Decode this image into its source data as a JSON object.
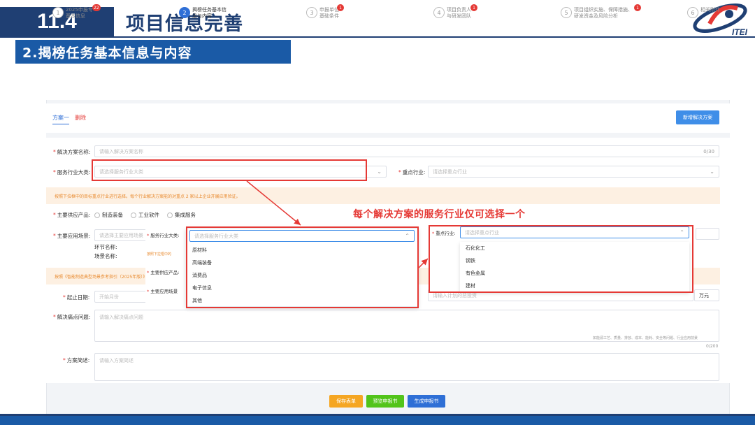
{
  "header": {
    "section_number": "11.4",
    "title": "项目信息完善",
    "subtitle": "2.揭榜任务基本信息与内容",
    "logo_text": "ITEI"
  },
  "steps": [
    {
      "num": "1",
      "label1": "2025申报专",
      "label2": "基本信息",
      "badge": "22"
    },
    {
      "num": "2",
      "label1": "揭榜任务基本信",
      "label2": "息与内容",
      "badge": ""
    },
    {
      "num": "3",
      "label1": "申报单位",
      "label2": "基础条件",
      "badge": "1"
    },
    {
      "num": "4",
      "label1": "项目负责人",
      "label2": "与研发团队",
      "badge": "1"
    },
    {
      "num": "5",
      "label1": "项目组织实施、保障措施、",
      "label2": "研发资金及风险分析",
      "badge": "1"
    },
    {
      "num": "6",
      "label1": "相关附件",
      "label2": "",
      "badge": ""
    }
  ],
  "tabs": {
    "tab1": "方案一",
    "tab2": "删除"
  },
  "add_button": "新增解决方案",
  "form": {
    "solution_name_label": "解决方案名称:",
    "solution_name_placeholder": "请输入解决方案名称",
    "solution_name_count": "0/30",
    "industry_label": "服务行业大类:",
    "industry_placeholder": "请选择服务行业大类",
    "key_industry_label": "重点行业:",
    "key_industry_placeholder": "请选择重点行业",
    "note1": "按照下拉框中的目标重点行业进行选择。每个行业解决方案能的对重点 2 家以上企业开展应用验证。",
    "main_product_label": "主要供应产品:",
    "product_options": [
      "制造装备",
      "工业软件",
      "集成服务"
    ],
    "scene_label": "主要应用场景:",
    "scene_placeholder": "请选择主要应用场景",
    "link_name_label": "环节名称:",
    "scene_name_label": "场景名称:",
    "note2": "按照《智能制造典型场景参考指引（2025年版）》",
    "start_date_label": "起止日期:",
    "start_date_placeholder": "开始月份",
    "budget_placeholder": "请输入计划的总投资",
    "budget_unit": "万元",
    "problem_label": "解决痛点问题:",
    "problem_placeholder": "请输入解决痛点问题",
    "problem_count": "0/200",
    "problem_hint": "如能源工艺、质量、排放、成本、能耗、安全等问题、行业应用前景",
    "desc_label": "方案简述:",
    "desc_placeholder": "请输入方案简述"
  },
  "overlay_left": {
    "industry_label": "服务行业大类:",
    "placeholder": "请选择服务行业大类",
    "items": [
      "原材料",
      "高端装备",
      "消费品",
      "电子信息",
      "其他"
    ],
    "ghost1": "按照下拉框中的",
    "ghost2": "主要供应产品:",
    "ghost3": "主要应用场景"
  },
  "overlay_right": {
    "label": "重点行业:",
    "placeholder": "请选择重点行业",
    "items": [
      "石化化工",
      "钢铁",
      "有色金属",
      "建材"
    ]
  },
  "annotation": "每个解决方案的服务行业仅可选择一个",
  "buttons": {
    "save": "保存表单",
    "preview": "预览申报书",
    "generate": "生成申报书"
  },
  "colors": {
    "primary": "#1a5aa6",
    "highlight": "#e53935",
    "save": "#f5a623",
    "preview": "#52c41a",
    "generate": "#2f6fd6"
  }
}
